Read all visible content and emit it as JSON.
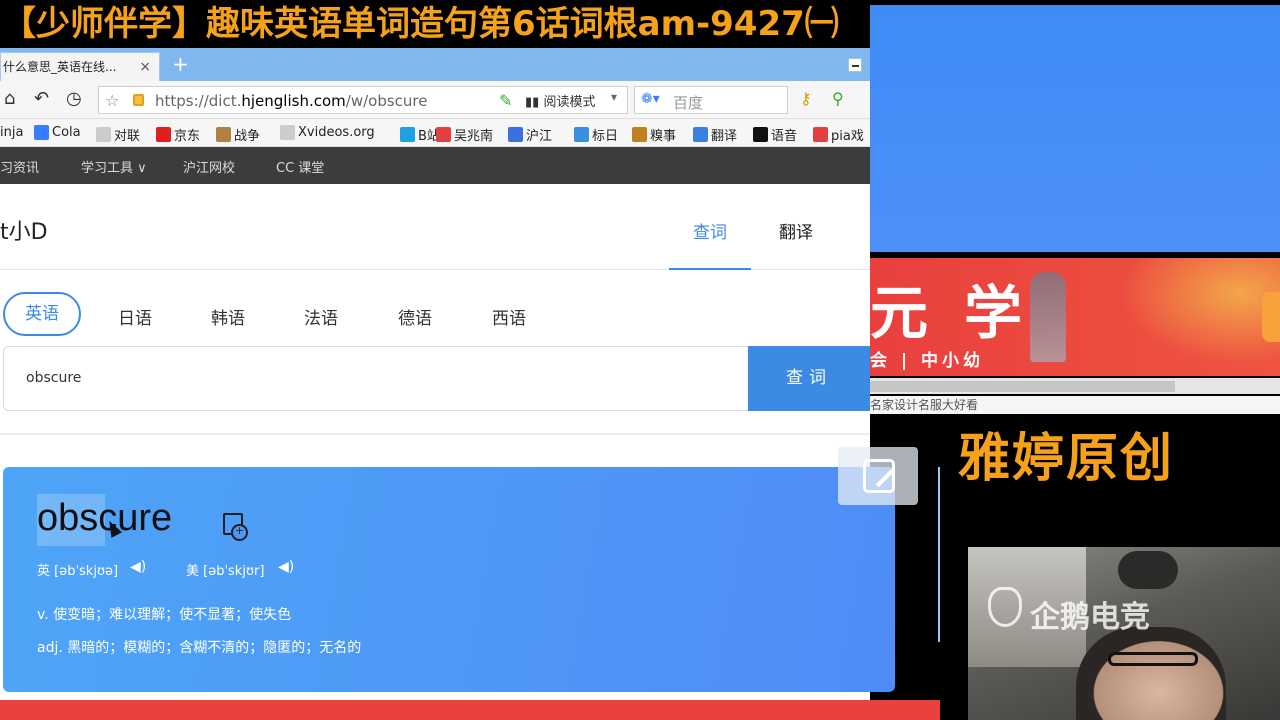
{
  "stream": {
    "title": "【少师伴学】趣味英语单词造句第6话词根am-9427㈠",
    "brand": "雅婷原创",
    "watermark": "企鹅电竞"
  },
  "browser": {
    "tab_title": "什么意思_英语在线...",
    "tab_close": "×",
    "new_tab": "+",
    "url_prefix": "https://dict.",
    "url_domain": "hjenglish.com",
    "url_path": "/w/obscure",
    "reader_mode": "阅读模式",
    "search_placeholder": "百度",
    "bookmarks": [
      "inja",
      "Cola",
      "对联",
      "京东",
      "战争",
      "Xvideos.org",
      "B站",
      "吴兆南",
      "沪江",
      "标日",
      "糗事",
      "翻译",
      "语音",
      "pia戏"
    ]
  },
  "site": {
    "nav": [
      "习资讯",
      "学习工具",
      "沪江网校",
      "CC 课堂"
    ],
    "logo": "t小D",
    "tabs": {
      "lookup": "查词",
      "translate": "翻译"
    },
    "languages": [
      "英语",
      "日语",
      "韩语",
      "法语",
      "德语",
      "西语"
    ],
    "query_value": "obscure",
    "query_button": "查词"
  },
  "entry": {
    "word": "obscure",
    "phonetic_uk": "英 [əbˈskjʊə]",
    "phonetic_us": "美 [əbˈskjʊr]",
    "def1": "v. 使变暗；难以理解；使不显著；使失色",
    "def2": "adj. 黑暗的；模糊的；含糊不清的；隐匿的；无名的"
  },
  "ad": {
    "big": "元学",
    "sub": "会 | 中小幼"
  },
  "misc": {
    "grey_text": "名家设计名服大好看"
  },
  "colors": {
    "accent": "#3d8ae5",
    "title_orange": "#f5a11a",
    "banner_red": "#e9403e"
  }
}
